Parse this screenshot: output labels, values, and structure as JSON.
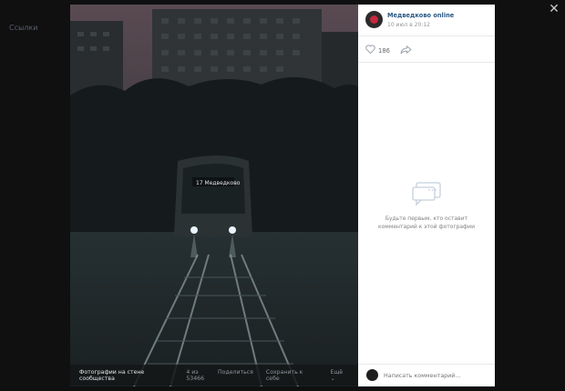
{
  "background": {
    "left_label": "Ссылки"
  },
  "viewer": {
    "close_icon": "close-icon",
    "album_label": "Фотографии на стене сообщества",
    "counter": "4 из 53466",
    "share_label": "Поделиться",
    "save_label": "Сохранить к себе",
    "more_label": "Ещё ⌄"
  },
  "post": {
    "author": "Медведково online",
    "date": "10 июл в 20:12",
    "likes": "186"
  },
  "comments": {
    "empty_text": "Будьте первым, кто оставит комментарий к этой фотографии",
    "placeholder": "Написать комментарий..."
  },
  "photo": {
    "tram_route_sign": "17 Медведково"
  },
  "colors": {
    "link": "#2a5885",
    "panel_bg": "#ffffff",
    "overlay": "#2a2b2d"
  }
}
